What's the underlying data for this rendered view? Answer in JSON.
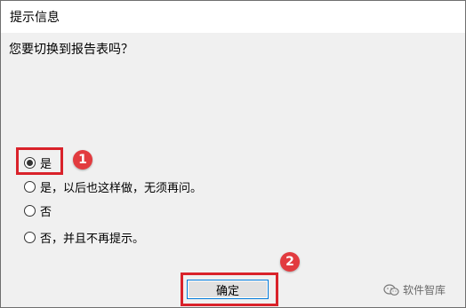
{
  "dialog": {
    "title": "提示信息",
    "question": "您要切换到报告表吗？"
  },
  "options": [
    {
      "label": "是",
      "checked": true
    },
    {
      "label": "是，以后也这样做，无须再问。",
      "checked": false
    },
    {
      "label": "否",
      "checked": false
    },
    {
      "label": "否，并且不再提示。",
      "checked": false
    }
  ],
  "buttons": {
    "ok_label": "确定"
  },
  "annotations": {
    "step1": "1",
    "step2": "2",
    "highlight_color": "#d9222a",
    "badge_color": "#e23b3f"
  },
  "watermark": {
    "text": "软件智库",
    "icon": "wechat-icon"
  }
}
